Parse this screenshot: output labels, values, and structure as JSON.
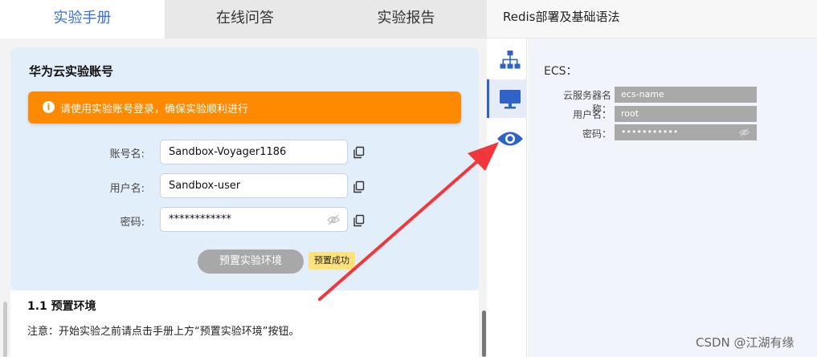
{
  "tabs": [
    {
      "label": "实验手册",
      "active": true
    },
    {
      "label": "在线问答",
      "active": false
    },
    {
      "label": "实验报告",
      "active": false
    }
  ],
  "lab_title": "Redis部署及基础语法",
  "card": {
    "title": "华为云实验账号",
    "alert": "请使用实验账号登录，确保实验顺利进行",
    "fields": [
      {
        "label": "账号名:",
        "value": "Sandbox-Voyager1186"
      },
      {
        "label": "用户名:",
        "value": "Sandbox-user"
      },
      {
        "label": "密码:",
        "value": "************"
      }
    ],
    "preset_button": "预置实验环境",
    "preset_badge": "预置成功"
  },
  "section": {
    "title": "1.1 预置环境",
    "text": "注意：开始实验之前请点击手册上方“预置实验环境”按钮。"
  },
  "ecs": {
    "heading": "ECS：",
    "fields": [
      {
        "label": "云服务器名称：",
        "value": "ecs-name"
      },
      {
        "label": "用户名：",
        "value": "root"
      },
      {
        "label": "密码：",
        "value": "•••••••••••"
      }
    ]
  },
  "watermark": "CSDN @江湖有缘",
  "colors": {
    "accent": "#3b6fd6",
    "alert": "#ff8a00",
    "badge": "#ffe27a",
    "rail_active": "#2f63c9",
    "arrow": "#f0383c"
  }
}
